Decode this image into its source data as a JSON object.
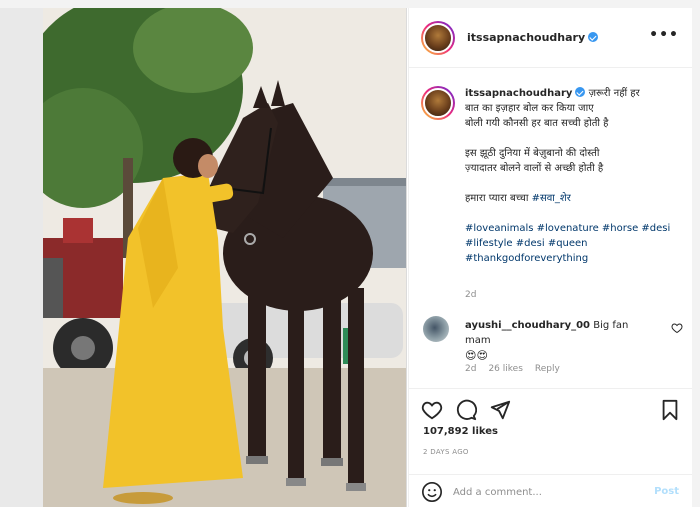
{
  "post": {
    "username": "itssapnachoudhary",
    "verified": true,
    "caption_lines": [
      "ज़रूरी नहीं हर",
      "बात का इज़हार बोल कर किया जाए",
      "बोली गयी कौनसी हर बात सच्ची होती है",
      "इस झूठी दुनिया में बेज़ुबानो की दोस्ती",
      "ज़्यादातर बोलने वालों से अच्छी होती है",
      "हमारा प्यारा बच्चा",
      "#सवा_शेर",
      "#loveanimals #lovenature #horse #desi",
      "#lifestyle #desi #queen",
      "#thankgodforeverything"
    ],
    "caption_time": "2d",
    "more_icon": "more-options-icon"
  },
  "comment": {
    "username": "ayushi__choudhary_00",
    "text": "Big fan mam",
    "emojis": "😍😍",
    "time": "2d",
    "likes": "26 likes",
    "reply": "Reply"
  },
  "actions": {
    "like_icon": "heart-icon",
    "comment_icon": "comment-icon",
    "share_icon": "share-icon",
    "save_icon": "bookmark-icon"
  },
  "likes": "107,892 likes",
  "posted_ago": "2 DAYS AGO",
  "add_comment": {
    "placeholder": "Add a comment...",
    "post_label": "Post",
    "post_color": "#b2dffc"
  },
  "colors": {
    "dress": "#f2c22a",
    "horse": "#2a1d1a",
    "hashtag": "#00376b",
    "verified": "#3897f0"
  }
}
